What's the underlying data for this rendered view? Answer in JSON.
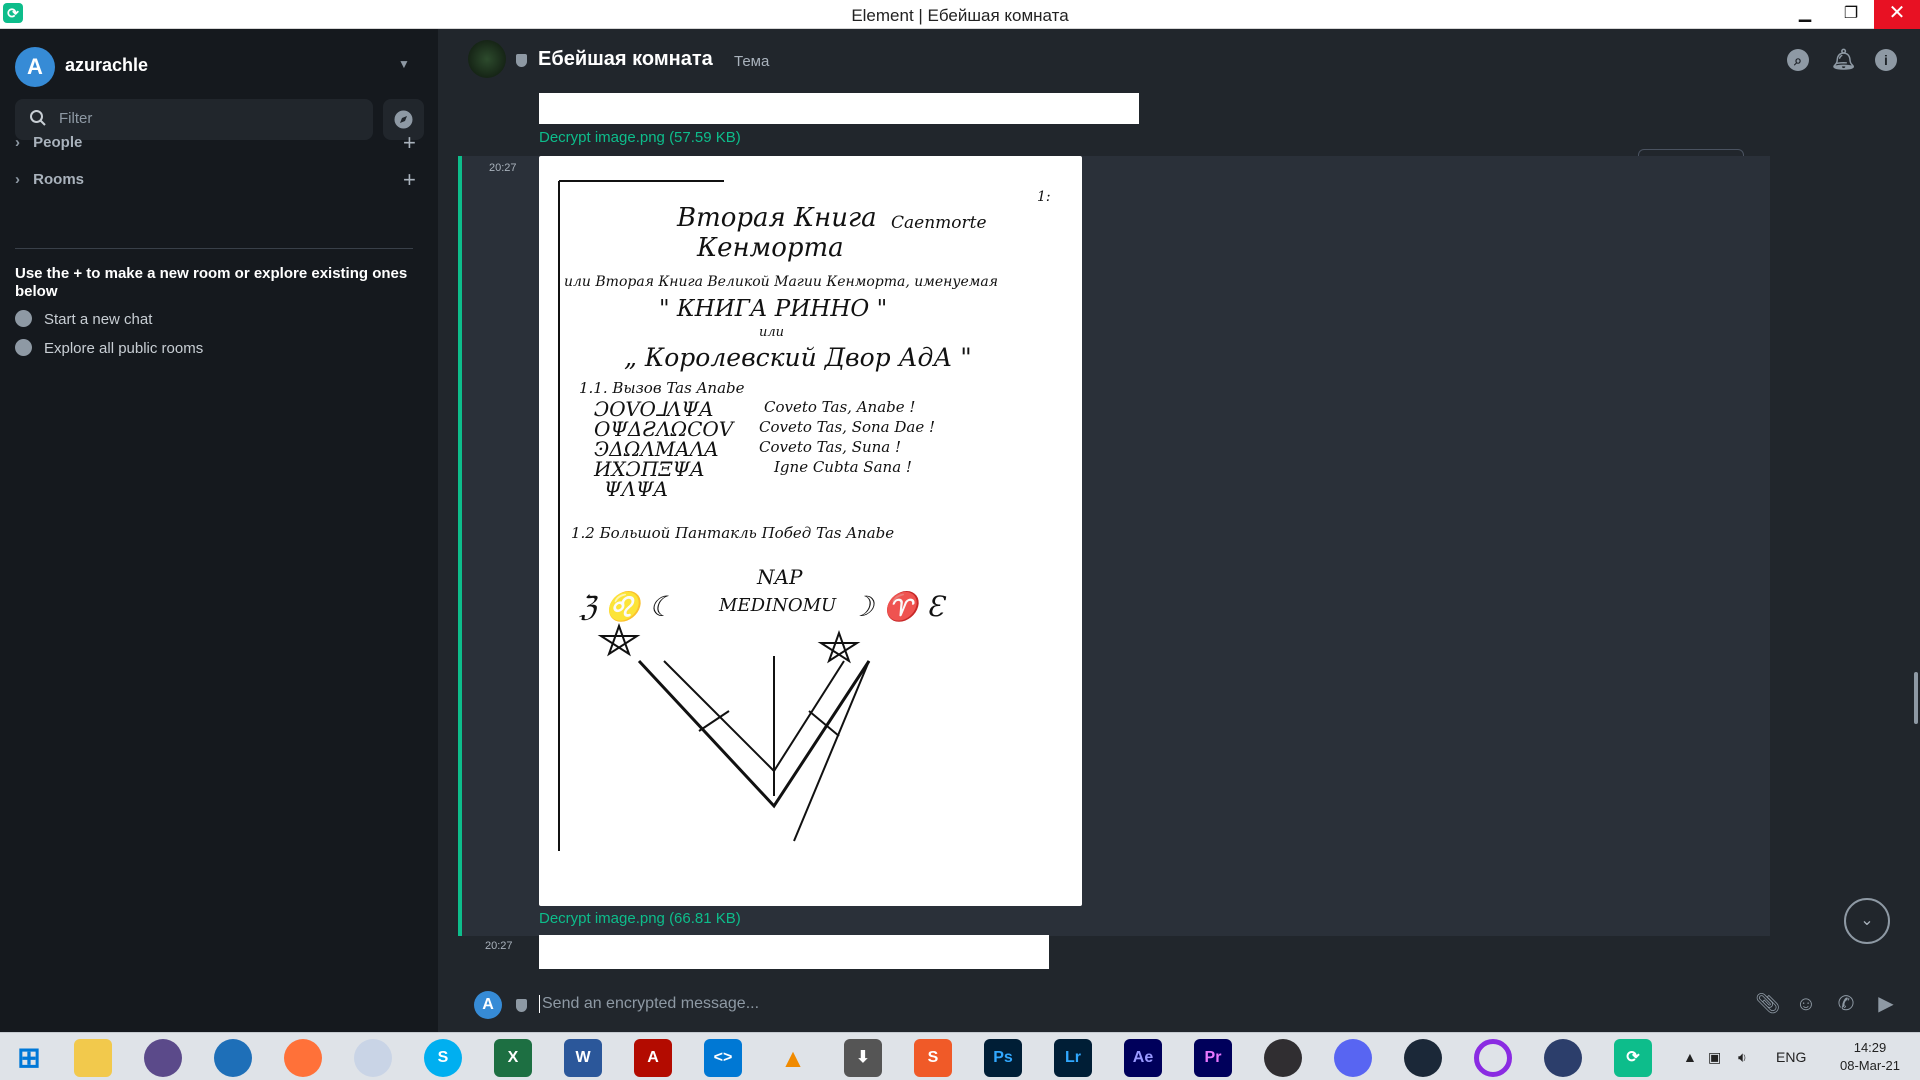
{
  "window": {
    "title": "Element | Ебейшая комната",
    "minimize": "▁",
    "maximize": "❐",
    "close": "✕"
  },
  "sidebar": {
    "user": {
      "avatar_letter": "A",
      "name": "azurachle"
    },
    "filter_placeholder": "Filter",
    "sections": [
      {
        "label": "People"
      },
      {
        "label": "Rooms"
      }
    ],
    "hint": "Use the + to make a new room or explore existing ones below",
    "links": [
      {
        "label": "Start a new chat"
      },
      {
        "label": "Explore all public rooms"
      }
    ]
  },
  "room": {
    "name": "Ебейшая комната",
    "topic": "Тема"
  },
  "timeline": {
    "files": [
      {
        "label": "Decrypt image.png (57.59 KB)"
      },
      {
        "label": "Decrypt image.png (66.81 KB)"
      }
    ],
    "times": [
      "20:27",
      "20:27"
    ],
    "image_text": {
      "page_number": "1:",
      "title1": "Вторая Книга",
      "title2": "Кенморта",
      "side": "Caenmorte",
      "line1": "или Вторая Книга Великой Магии Кенморта, именуемая",
      "line2": "\" КНИГА РИННО \"",
      "line3": "или",
      "line4": "„ Королевский Двор АдА \"",
      "s11": "1.1. Вызов Tas Anabe",
      "chant": [
        "Coveto Tas, Anabe !",
        "Coveto Tas, Sona Dae !",
        "Coveto Tas, Suna !",
        "Igne Cubta Sana !"
      ],
      "s12": "1.2 Большой Пантакль Побед Tas Anabe",
      "nap": "NAP",
      "medinomu": "MEDINOMU"
    }
  },
  "composer": {
    "avatar_letter": "A",
    "placeholder": "Send an encrypted message..."
  },
  "taskbar": {
    "apps": [
      {
        "name": "Photoshop",
        "label": "Ps",
        "color": "#001e36"
      },
      {
        "name": "Lightroom",
        "label": "Lr",
        "color": "#001e36"
      },
      {
        "name": "After Effects",
        "label": "Ae",
        "color": "#00005b"
      },
      {
        "name": "Premiere",
        "label": "Pr",
        "color": "#00005b"
      }
    ],
    "language": "ENG",
    "time": "14:29",
    "date": "08-Mar-21"
  }
}
